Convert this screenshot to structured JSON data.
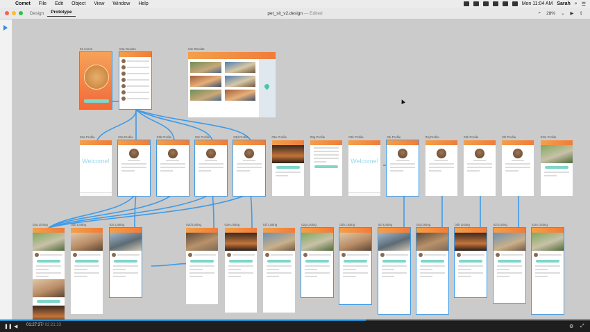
{
  "menubar": {
    "app_name": "Comet",
    "items": [
      "File",
      "Edit",
      "Object",
      "View",
      "Window",
      "Help"
    ],
    "clock": "Mon 11:04 AM",
    "user": "Sarah"
  },
  "toolbar": {
    "modes": [
      "Design",
      "Prototype"
    ],
    "active_mode": "Prototype",
    "doc_title": "pet_sit_v2.design",
    "doc_status": "— Edited",
    "zoom": "28%"
  },
  "artboards": {
    "row1": [
      {
        "label": "01 Home"
      },
      {
        "label": "04a Results"
      },
      {
        "label": "04c Results"
      }
    ],
    "row2": [
      {
        "label": "02a Profile"
      },
      {
        "label": "03a Profile"
      },
      {
        "label": "03b Profile"
      },
      {
        "label": "03c Profile"
      },
      {
        "label": "03d Profile"
      },
      {
        "label": "03e Profile"
      },
      {
        "label": "03g Profile"
      },
      {
        "label": "03h Profile"
      },
      {
        "label": "03i Profile"
      },
      {
        "label": "03j Profile"
      },
      {
        "label": "03k Profile"
      },
      {
        "label": "03l Profile"
      },
      {
        "label": "03m Profile"
      }
    ],
    "row3": [
      {
        "label": "02a Listing"
      },
      {
        "label": "02b Listing"
      },
      {
        "label": "02c Listing"
      },
      {
        "label": "02d Listing"
      },
      {
        "label": "02e Listing"
      },
      {
        "label": "02f Listing"
      },
      {
        "label": "02g Listing"
      },
      {
        "label": "02h Listing"
      },
      {
        "label": "02i Listing"
      },
      {
        "label": "02j Listing"
      },
      {
        "label": "02k Listing"
      },
      {
        "label": "02l Listing"
      },
      {
        "label": "02m Listing"
      }
    ],
    "welcome_text": "Welcome!"
  },
  "video": {
    "current": "01:27:37",
    "duration": "/ 02:21:23",
    "progress": 0.62
  },
  "colors": {
    "accent": "#3d9be9",
    "header_orange": "#f07c3a",
    "teal": "#7fd6c9",
    "canvas": "#cbcbcb"
  }
}
